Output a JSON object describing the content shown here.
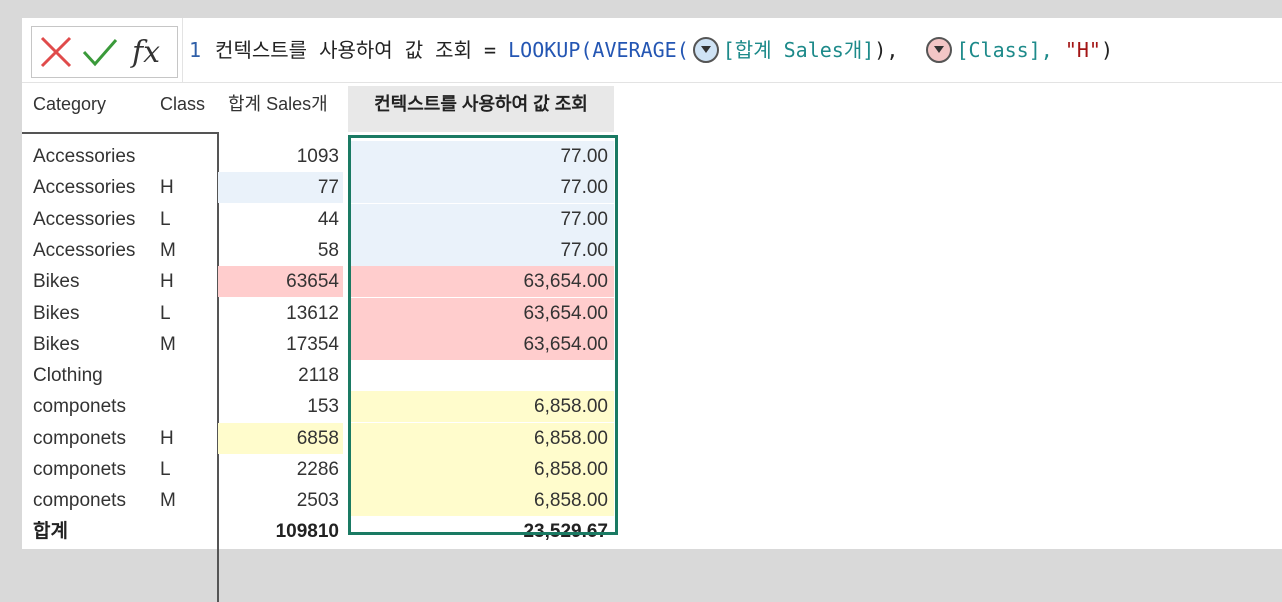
{
  "formula_bar": {
    "line_number": "1",
    "measure_name": "컨텍스트를 사용하여 값 조회",
    "equals": "=",
    "func_lookup": "LOOKUP(",
    "func_average": "AVERAGE(",
    "arg1": "[합계 Sales개]",
    "close_avg": "),",
    "arg2": "[Class],",
    "arg3": "\"H\"",
    "close_lookup": ")",
    "context_icons": [
      "context-blue",
      "context-red"
    ]
  },
  "table": {
    "headers": [
      "Category",
      "Class",
      "합계 Sales개",
      "컨텍스트를 사용하여 값 조회"
    ],
    "rows": [
      {
        "category": "Accessories",
        "class": "",
        "sales": "1093",
        "lookup": "77.00",
        "sales_bg": "",
        "lookup_bg": "#eaf2fa"
      },
      {
        "category": "Accessories",
        "class": "H",
        "sales": "77",
        "lookup": "77.00",
        "sales_bg": "#eaf2fa",
        "lookup_bg": "#eaf2fa"
      },
      {
        "category": "Accessories",
        "class": "L",
        "sales": "44",
        "lookup": "77.00",
        "sales_bg": "",
        "lookup_bg": "#eaf2fa"
      },
      {
        "category": "Accessories",
        "class": "M",
        "sales": "58",
        "lookup": "77.00",
        "sales_bg": "",
        "lookup_bg": "#eaf2fa"
      },
      {
        "category": "Bikes",
        "class": "H",
        "sales": "63654",
        "lookup": "63,654.00",
        "sales_bg": "#ffcdcd",
        "lookup_bg": "#ffcdcd"
      },
      {
        "category": "Bikes",
        "class": "L",
        "sales": "13612",
        "lookup": "63,654.00",
        "sales_bg": "",
        "lookup_bg": "#ffcdcd"
      },
      {
        "category": "Bikes",
        "class": "M",
        "sales": "17354",
        "lookup": "63,654.00",
        "sales_bg": "",
        "lookup_bg": "#ffcdcd"
      },
      {
        "category": "Clothing",
        "class": "",
        "sales": "2118",
        "lookup": "",
        "sales_bg": "",
        "lookup_bg": ""
      },
      {
        "category": "componets",
        "class": "",
        "sales": "153",
        "lookup": "6,858.00",
        "sales_bg": "",
        "lookup_bg": "#fffccc"
      },
      {
        "category": "componets",
        "class": "H",
        "sales": "6858",
        "lookup": "6,858.00",
        "sales_bg": "#fffccc",
        "lookup_bg": "#fffccc"
      },
      {
        "category": "componets",
        "class": "L",
        "sales": "2286",
        "lookup": "6,858.00",
        "sales_bg": "",
        "lookup_bg": "#fffccc"
      },
      {
        "category": "componets",
        "class": "M",
        "sales": "2503",
        "lookup": "6,858.00",
        "sales_bg": "",
        "lookup_bg": "#fffccc"
      }
    ],
    "total": {
      "label": "합계",
      "sales": "109810",
      "lookup": "23,529.67"
    }
  },
  "colors": {
    "selection_border": "#1a7a63",
    "cancel_x": "#e04b4b",
    "confirm_check": "#3a9a3a"
  }
}
